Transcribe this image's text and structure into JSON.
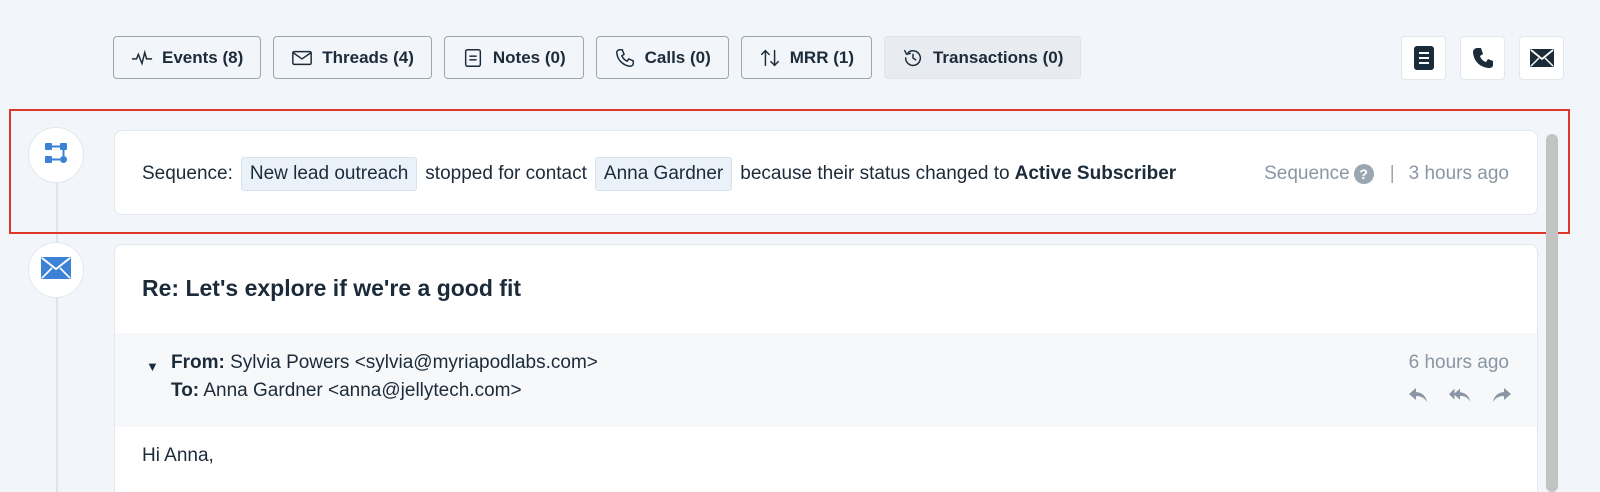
{
  "filters": [
    {
      "label": "Events (8)",
      "icon": "activity-icon",
      "active": false
    },
    {
      "label": "Threads (4)",
      "icon": "mail-outline-icon",
      "active": false
    },
    {
      "label": "Notes (0)",
      "icon": "note-icon",
      "active": false
    },
    {
      "label": "Calls (0)",
      "icon": "phone-outline-icon",
      "active": false
    },
    {
      "label": "MRR (1)",
      "icon": "arrows-up-down-icon",
      "active": false
    },
    {
      "label": "Transactions (0)",
      "icon": "history-icon",
      "active": true
    }
  ],
  "quick_actions": [
    {
      "icon": "note-solid-icon"
    },
    {
      "icon": "phone-solid-icon"
    },
    {
      "icon": "mail-solid-icon"
    }
  ],
  "sequence_event": {
    "icon": "sequence-icon",
    "prefix": "Sequence:",
    "sequence_name": "New lead outreach",
    "middle": "stopped for contact",
    "contact_name": "Anna Gardner",
    "suffix": "because their status changed to",
    "status": "Active Subscriber",
    "source": "Sequence",
    "help_glyph": "?",
    "separator": "|",
    "time": "3 hours ago"
  },
  "email_event": {
    "icon": "mail-icon",
    "subject": "Re: Let's explore if we're a good fit",
    "from_label": "From:",
    "from_value": "Sylvia Powers <sylvia@myriapodlabs.com>",
    "to_label": "To:",
    "to_value": "Anna Gardner <anna@jellytech.com>",
    "time": "6 hours ago",
    "actions": [
      "reply-icon",
      "reply-all-icon",
      "forward-icon"
    ],
    "body_first_line": "Hi Anna,"
  },
  "colors": {
    "background": "#f2f5f9",
    "accent_blue": "#3b82d6",
    "highlight_red": "#e0372b",
    "chip_bg": "#eaf1f8",
    "muted_text": "#8a96a3"
  }
}
